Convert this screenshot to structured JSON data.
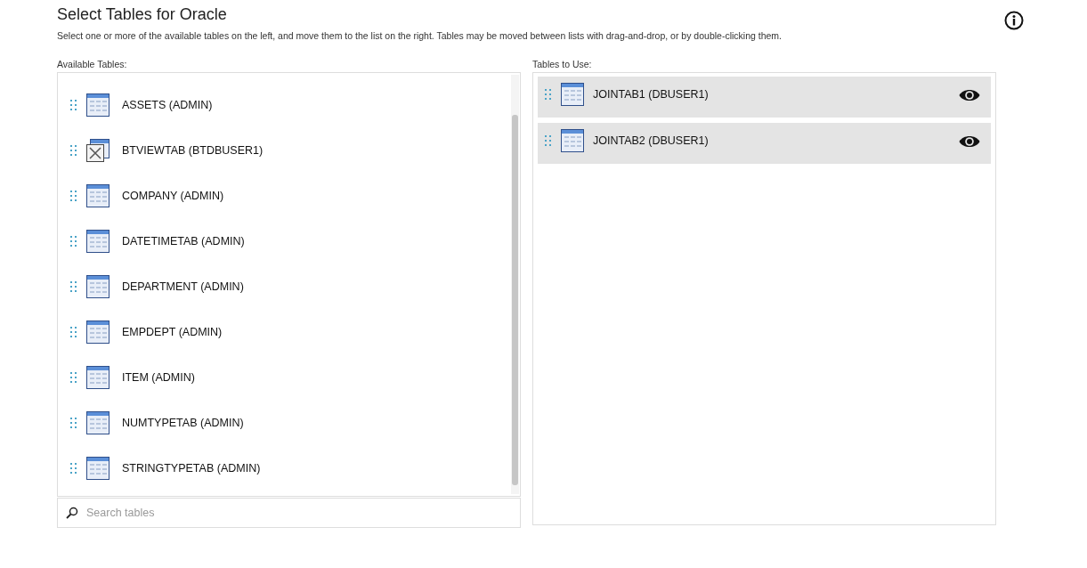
{
  "title": "Select Tables for Oracle",
  "description": "Select one or more of the available tables on the left, and move them to the list on the right. Tables may be moved between lists with drag-and-drop, or by double-clicking them.",
  "available": {
    "label": "Available Tables:",
    "items": [
      {
        "name": "ASSETS (ADMIN)",
        "kind": "table"
      },
      {
        "name": "BTVIEWTAB (BTDBUSER1)",
        "kind": "view"
      },
      {
        "name": "COMPANY (ADMIN)",
        "kind": "table"
      },
      {
        "name": "DATETIMETAB (ADMIN)",
        "kind": "table"
      },
      {
        "name": "DEPARTMENT (ADMIN)",
        "kind": "table"
      },
      {
        "name": "EMPDEPT (ADMIN)",
        "kind": "table"
      },
      {
        "name": "ITEM (ADMIN)",
        "kind": "table"
      },
      {
        "name": "NUMTYPETAB (ADMIN)",
        "kind": "table"
      },
      {
        "name": "STRINGTYPETAB (ADMIN)",
        "kind": "table"
      }
    ],
    "search": {
      "placeholder": "Search tables"
    }
  },
  "selected": {
    "label": "Tables to Use:",
    "items": [
      {
        "name": "JOINTAB1 (DBUSER1)",
        "kind": "table"
      },
      {
        "name": "JOINTAB2 (DBUSER1)",
        "kind": "table"
      }
    ]
  }
}
